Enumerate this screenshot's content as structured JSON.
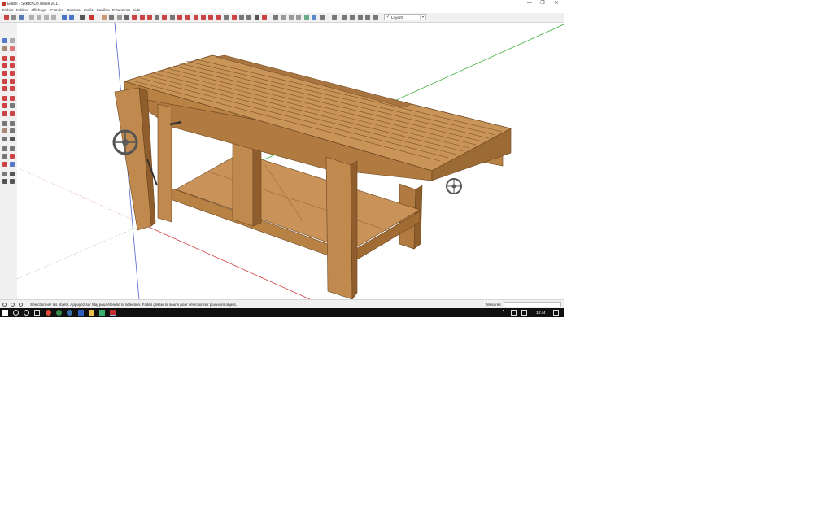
{
  "window": {
    "title": "Etabli - SketchUp Make 2017",
    "minimize": "—",
    "maximize": "❐",
    "close": "✕"
  },
  "menu": {
    "items": [
      "Fichier",
      "Edition",
      "Affichage",
      "Caméra",
      "Dessiner",
      "Outils",
      "Fenêtre",
      "Extensions",
      "Aide"
    ]
  },
  "toolbar": {
    "layer": {
      "check": "✓",
      "value": "Layer0",
      "arrow": "▾"
    }
  },
  "status": {
    "message": "Sélectionnez les objets. Appuyez sur Maj pour étendre la sélection. Faites glisser la souris pour sélectionner plusieurs objets.",
    "measure_label": "Mesures",
    "measure_value": "",
    "icons": [
      "info-icon",
      "geo-location-icon",
      "credits-icon"
    ]
  },
  "taskbar": {
    "time": "18:44"
  },
  "colors": {
    "wood_top": "#c08a4e",
    "wood_side": "#b07a40",
    "wood_dark": "#8f5e2c",
    "axis_red": "#d04040",
    "axis_green": "#40b040",
    "axis_blue": "#5060d0"
  }
}
